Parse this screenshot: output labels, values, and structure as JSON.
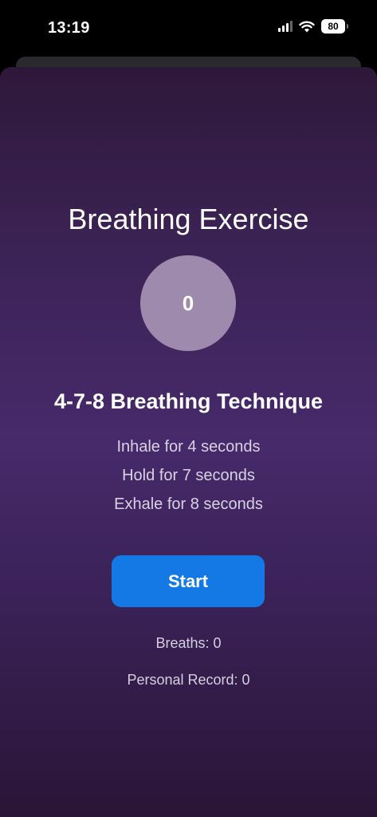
{
  "status_bar": {
    "time": "13:19",
    "battery": "80",
    "icons": [
      "cellular-signal-icon",
      "wifi-icon",
      "battery-icon"
    ]
  },
  "colors": {
    "background_top": "#2e1839",
    "background_mid": "#462a6b",
    "counter_circle": "#9d8aac",
    "start_button": "#1479e4"
  },
  "main": {
    "title": "Breathing Exercise",
    "counter": "0",
    "technique_title": "4-7-8 Breathing Technique",
    "steps": [
      "Inhale for 4 seconds",
      "Hold for 7 seconds",
      "Exhale for 8 seconds"
    ],
    "start_label": "Start",
    "breaths": "Breaths: 0",
    "personal_record": "Personal Record: 0"
  }
}
